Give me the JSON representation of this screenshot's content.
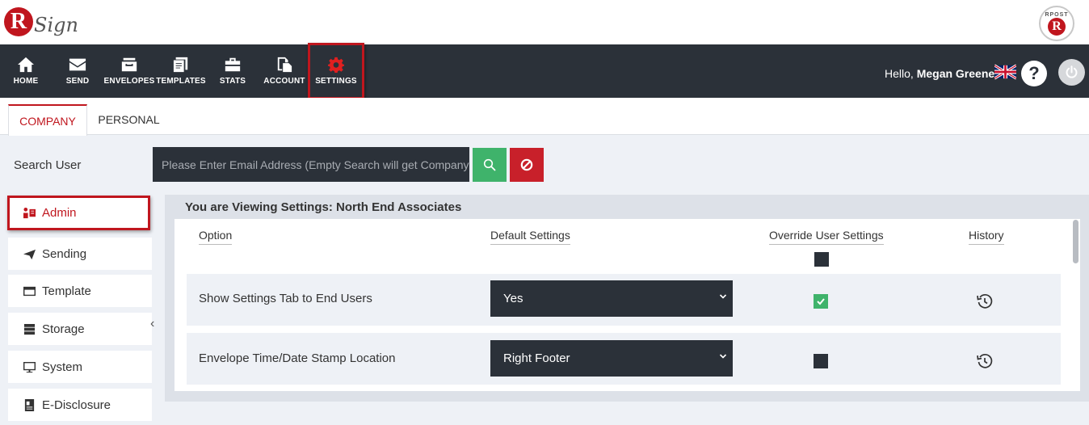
{
  "brand": {
    "logo_letter": "R",
    "logo_text": "Sign",
    "badge_text": "RPOST",
    "badge_letter": "R"
  },
  "nav": {
    "items": [
      {
        "label": "HOME",
        "icon": "home-icon"
      },
      {
        "label": "SEND",
        "icon": "envelope-icon"
      },
      {
        "label": "ENVELOPES",
        "icon": "inbox-icon"
      },
      {
        "label": "TEMPLATES",
        "icon": "templates-icon"
      },
      {
        "label": "STATS",
        "icon": "briefcase-icon"
      },
      {
        "label": "ACCOUNT",
        "icon": "account-icon"
      },
      {
        "label": "SETTINGS",
        "icon": "gear-icon",
        "active": true
      }
    ],
    "greeting_prefix": "Hello,",
    "user_name": "Megan Greene",
    "help_symbol": "?"
  },
  "tabs": [
    {
      "label": "COMPANY",
      "active": true
    },
    {
      "label": "PERSONAL",
      "active": false
    }
  ],
  "search": {
    "label": "Search User",
    "placeholder": "Please Enter Email Address (Empty Search will get Company Settings)"
  },
  "sidebar": {
    "items": [
      {
        "label": "Admin",
        "icon": "admin-icon",
        "active": true
      },
      {
        "label": "Sending",
        "icon": "paper-plane-icon"
      },
      {
        "label": "Template",
        "icon": "window-icon"
      },
      {
        "label": "Storage",
        "icon": "server-icon"
      },
      {
        "label": "System",
        "icon": "monitor-icon"
      },
      {
        "label": "E-Disclosure",
        "icon": "document-icon"
      }
    ],
    "collapse_glyph": "‹"
  },
  "settings": {
    "title": "You are Viewing Settings: North End Associates",
    "columns": {
      "option": "Option",
      "default": "Default Settings",
      "override": "Override User Settings",
      "history": "History"
    },
    "master_override_checked": false,
    "rows": [
      {
        "option": "Show Settings Tab to End Users",
        "value": "Yes",
        "override": true
      },
      {
        "option": "Envelope Time/Date Stamp Location",
        "value": "Right Footer",
        "override": false
      }
    ]
  },
  "colors": {
    "accent_red": "#c0161e",
    "nav_dark": "#2b3139",
    "success_green": "#3fb36b",
    "danger_red": "#c8202a"
  }
}
